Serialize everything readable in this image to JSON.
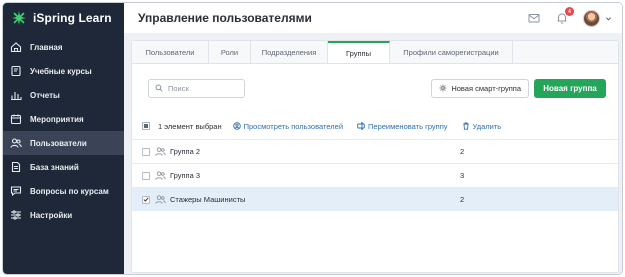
{
  "app": {
    "logo_text": "iSpring Learn",
    "brand_color": "#23a65a"
  },
  "sidebar": {
    "items": [
      {
        "label": "Главная",
        "icon": "home-icon"
      },
      {
        "label": "Учебные курсы",
        "icon": "book-icon"
      },
      {
        "label": "Отчеты",
        "icon": "chart-icon"
      },
      {
        "label": "Мероприятия",
        "icon": "calendar-icon"
      },
      {
        "label": "Пользователи",
        "icon": "users-icon",
        "active": true
      },
      {
        "label": "База знаний",
        "icon": "document-icon"
      },
      {
        "label": "Вопросы по курсам",
        "icon": "chat-icon"
      },
      {
        "label": "Настройки",
        "icon": "sliders-icon"
      }
    ]
  },
  "header": {
    "title": "Управление пользователями",
    "notification_count": "4"
  },
  "tabs": [
    {
      "label": "Пользователи"
    },
    {
      "label": "Роли"
    },
    {
      "label": "Подразделения"
    },
    {
      "label": "Группы",
      "active": true
    },
    {
      "label": "Профили саморегистрации"
    }
  ],
  "toolbar": {
    "search_placeholder": "Поиск",
    "smart_group_label": "Новая смарт-группа",
    "new_group_label": "Новая группа"
  },
  "actions": {
    "selected_text": "1 элемент выбран",
    "view_users": "Просмотреть пользователей",
    "rename_group": "Переименовать группу",
    "delete": "Удалить"
  },
  "groups": [
    {
      "name": "Группа 2",
      "count": "2",
      "checked": false
    },
    {
      "name": "Группа 3",
      "count": "3",
      "checked": false
    },
    {
      "name": "Стажеры Машинисты",
      "count": "2",
      "checked": true
    }
  ]
}
